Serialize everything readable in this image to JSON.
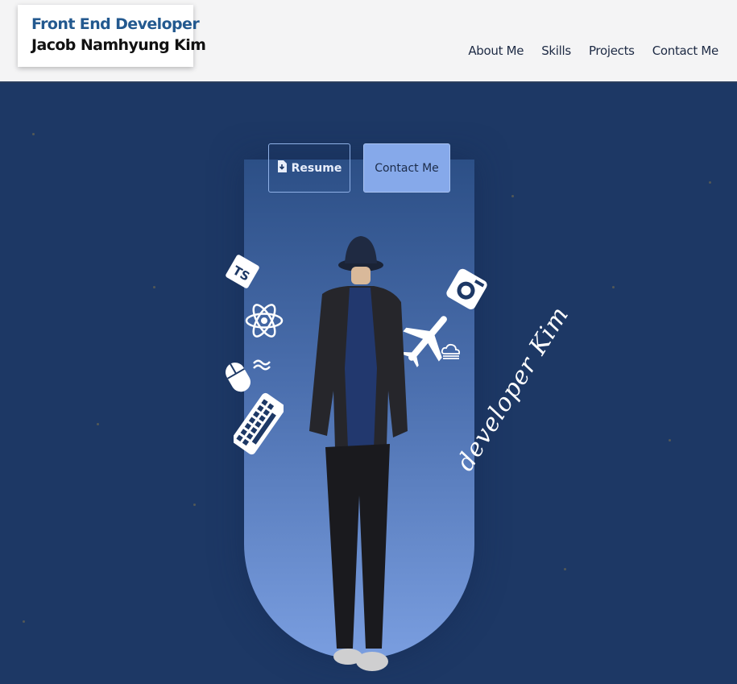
{
  "header": {
    "role": "Front End Developer",
    "name": "Jacob Namhyung Kim",
    "nav": [
      "About Me",
      "Skills",
      "Projects",
      "Contact Me"
    ]
  },
  "hero": {
    "resume_label": "Resume",
    "contact_label": "Contact Me",
    "script_text": "developer Kim",
    "icons": [
      "typescript-icon",
      "react-icon",
      "mouse-icon",
      "tailwind-icon",
      "keyboard-icon",
      "airplane-icon",
      "cloud-icon",
      "camera-icon",
      "download-file-icon"
    ]
  },
  "colors": {
    "background": "#1d3865",
    "header_bg": "#f4f4f5",
    "brand_role": "#23598f",
    "button_contact": "#86a9ea",
    "capsule_bottom": "#7a9ee0"
  }
}
